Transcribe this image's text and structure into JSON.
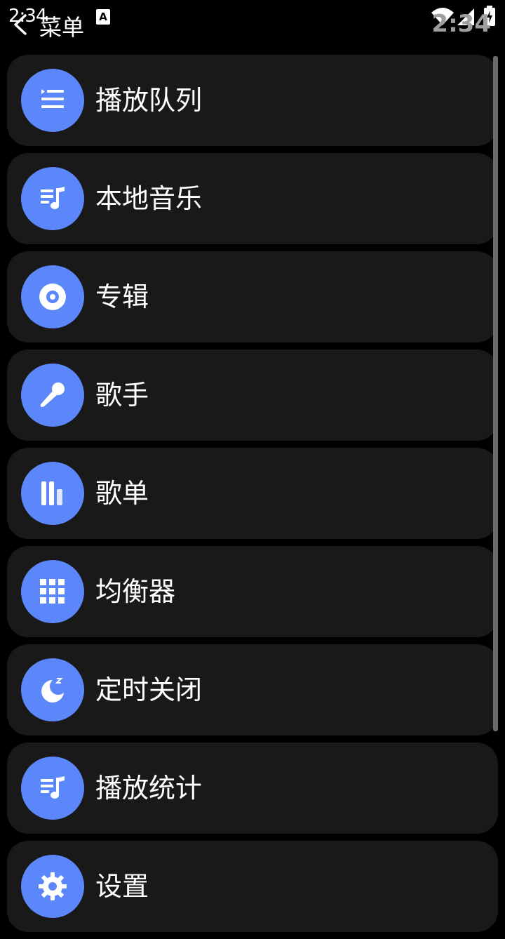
{
  "status_bar": {
    "time": "2:34",
    "clock_overlay": "2:34"
  },
  "header": {
    "title": "菜单"
  },
  "menu": {
    "items": [
      {
        "label": "播放队列",
        "icon": "queue-list-icon"
      },
      {
        "label": "本地音乐",
        "icon": "music-library-icon"
      },
      {
        "label": "专辑",
        "icon": "album-disc-icon"
      },
      {
        "label": "歌手",
        "icon": "microphone-icon"
      },
      {
        "label": "歌单",
        "icon": "playlist-bars-icon"
      },
      {
        "label": "均衡器",
        "icon": "equalizer-grid-icon"
      },
      {
        "label": "定时关闭",
        "icon": "sleep-moon-icon"
      },
      {
        "label": "播放统计",
        "icon": "play-stats-icon"
      },
      {
        "label": "设置",
        "icon": "gear-icon"
      }
    ]
  },
  "colors": {
    "accent": "#5b87fb",
    "item_background": "#191919",
    "background": "#000000",
    "text": "#ffffff"
  }
}
